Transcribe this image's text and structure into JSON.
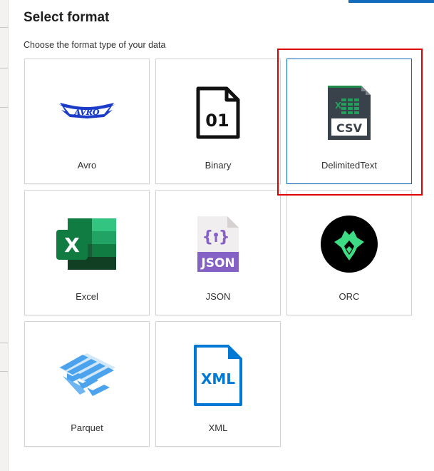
{
  "header": {
    "title": "Select format",
    "subtitle": "Choose the format type of your data"
  },
  "formats": [
    {
      "label": "Avro",
      "icon": "avro-logo-icon"
    },
    {
      "label": "Binary",
      "icon": "binary-file-icon"
    },
    {
      "label": "DelimitedText",
      "icon": "csv-file-icon",
      "selected": true
    },
    {
      "label": "Excel",
      "icon": "excel-icon"
    },
    {
      "label": "JSON",
      "icon": "json-file-icon"
    },
    {
      "label": "ORC",
      "icon": "orc-icon"
    },
    {
      "label": "Parquet",
      "icon": "parquet-icon"
    },
    {
      "label": "XML",
      "icon": "xml-file-icon"
    }
  ],
  "colors": {
    "selected_border": "#0f6cbd",
    "annotation_box": "#e00000",
    "excel_green": "#107c41",
    "json_purple": "#8661c5",
    "xml_blue": "#0078d4",
    "parquet_blue": "#4ba3ed",
    "avro_blue": "#1a3cc8"
  }
}
